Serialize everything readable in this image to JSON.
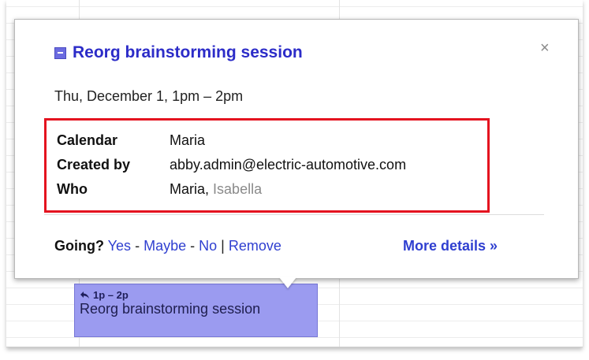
{
  "popup": {
    "title": "Reorg brainstorming session",
    "close_label": "×",
    "date_time": "Thu, December 1, 1pm – 2pm",
    "details": {
      "calendar_label": "Calendar",
      "calendar_value": "Maria",
      "created_by_label": "Created by",
      "created_by_value": "abby.admin@electric-automotive.com",
      "who_label": "Who",
      "who_primary": "Maria",
      "who_separator": ",",
      "who_secondary": "Isabella"
    },
    "rsvp": {
      "going_label": "Going?",
      "yes": "Yes",
      "maybe": "Maybe",
      "no": "No",
      "remove": "Remove",
      "dash": "-",
      "pipe": "|"
    },
    "more_details": "More details »"
  },
  "event_block": {
    "time": "1p – 2p",
    "title": "Reorg brainstorming session"
  },
  "colors": {
    "title_link": "#2c2cc8",
    "link": "#2f3fd0",
    "highlight_border": "#e4131f",
    "event_fill": "#9b9bf0"
  },
  "icons": {
    "title": "calendar-event-icon",
    "close": "close-icon",
    "event_time": "reply-arrow-icon"
  }
}
